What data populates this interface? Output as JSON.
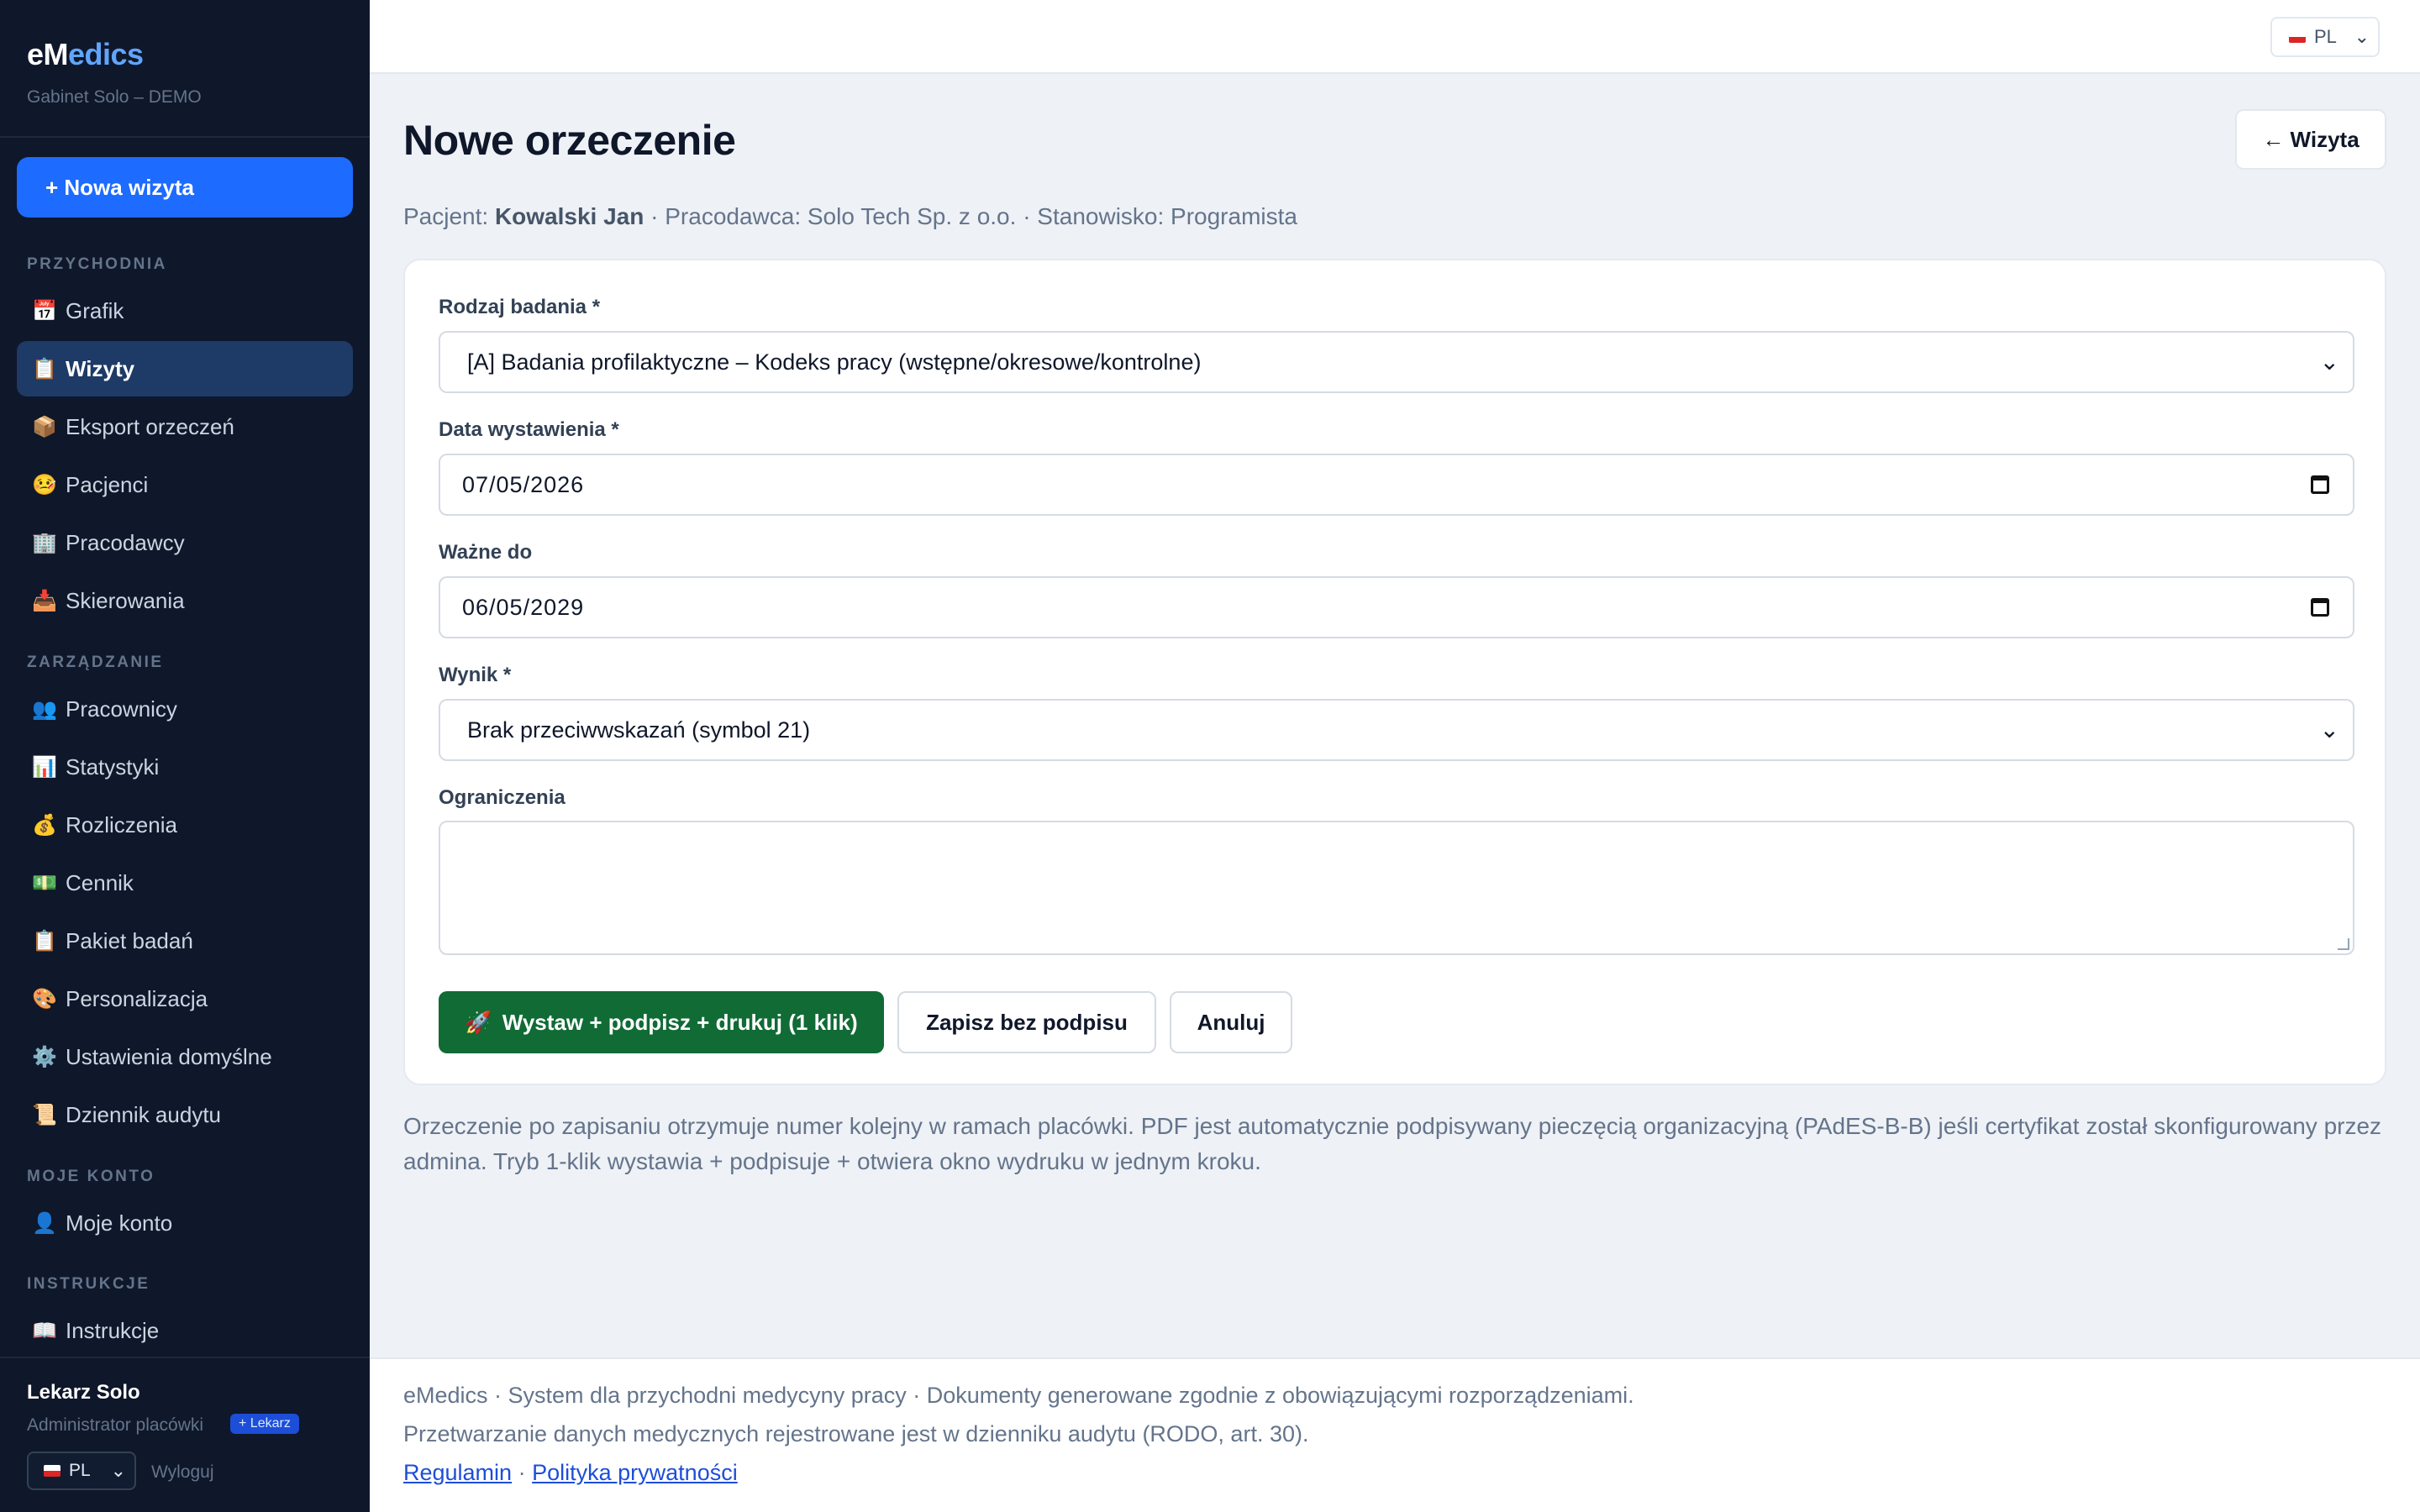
{
  "app": {
    "brand_prefix": "eM",
    "brand_accent": "edics",
    "subtitle": "Gabinet Solo – DEMO",
    "new_visit_label": "+ Nowa wizyta"
  },
  "sidebar": {
    "sections": [
      {
        "label": "PRZYCHODNIA"
      },
      {
        "label": "ZARZĄDZANIE"
      },
      {
        "label": "MOJE KONTO"
      },
      {
        "label": "INSTRUKCJE"
      }
    ],
    "items": [
      {
        "icon": "📅",
        "label": "Grafik"
      },
      {
        "icon": "📋",
        "label": "Wizyty"
      },
      {
        "icon": "📦",
        "label": "Eksport orzeczeń"
      },
      {
        "icon": "🤒",
        "label": "Pacjenci"
      },
      {
        "icon": "🏢",
        "label": "Pracodawcy"
      },
      {
        "icon": "📥",
        "label": "Skierowania"
      },
      {
        "icon": "👥",
        "label": "Pracownicy"
      },
      {
        "icon": "📊",
        "label": "Statystyki"
      },
      {
        "icon": "💰",
        "label": "Rozliczenia"
      },
      {
        "icon": "💵",
        "label": "Cennik"
      },
      {
        "icon": "📋",
        "label": "Pakiet badań"
      },
      {
        "icon": "🎨",
        "label": "Personalizacja"
      },
      {
        "icon": "⚙️",
        "label": "Ustawienia domyślne"
      },
      {
        "icon": "📜",
        "label": "Dziennik audytu"
      },
      {
        "icon": "👤",
        "label": "Moje konto"
      },
      {
        "icon": "📖",
        "label": "Instrukcje"
      }
    ],
    "user": {
      "name": "Lekarz Solo",
      "role": "Administrator placówki",
      "badge": "+ Lekarz",
      "lang": "PL",
      "logout": "Wyloguj"
    }
  },
  "topbar": {
    "lang": "PL"
  },
  "main": {
    "title": "Nowe orzeczenie",
    "back_label": "← Wizyta",
    "meta": {
      "patient_prefix": "Pacjent:",
      "patient_name": "Kowalski Jan",
      "rest": "· Pracodawca: Solo Tech Sp. z o.o. · Stanowisko: Programista"
    },
    "form": {
      "exam_type_label": "Rodzaj badania *",
      "exam_type_value": "[A] Badania profilaktyczne – Kodeks pracy (wstępne/okresowe/kontrolne)",
      "issue_date_label": "Data wystawienia *",
      "issue_date_value": "07/05/2026",
      "valid_until_label": "Ważne do",
      "valid_until_value": "06/05/2029",
      "result_label": "Wynik *",
      "result_value": "Brak przeciwwskazań (symbol 21)",
      "restrictions_label": "Ograniczenia",
      "restrictions_value": ""
    },
    "buttons": {
      "primary_icon": "🚀",
      "primary": "Wystaw + podpisz + drukuj (1 klik)",
      "save_unsigned": "Zapisz bez podpisu",
      "cancel": "Anuluj"
    },
    "info": "Orzeczenie po zapisaniu otrzymuje numer kolejny w ramach placówki. PDF jest automatycznie podpisywany pieczęcią organizacyjną (PAdES-B-B) jeśli certyfikat został skonfigurowany przez admina. Tryb 1-klik wystawia + podpisuje + otwiera okno wydruku w jednym kroku."
  },
  "footer": {
    "line1": "eMedics · System dla przychodni medycyny pracy · Dokumenty generowane zgodnie z obowiązującymi rozporządzeniami.",
    "line2": "Przetwarzanie danych medycznych rejestrowane jest w dzienniku audytu (RODO, art. 30).",
    "terms": "Regulamin",
    "separator": "·",
    "privacy": "Polityka prywatności"
  },
  "colors": {
    "sidebar_bg": "#0f172a",
    "brand_accent": "#60a5fa",
    "primary_blue": "#1d6bff",
    "active_nav": "#1e3a66",
    "primary_green": "#106b35",
    "link": "#1d4ed8"
  }
}
